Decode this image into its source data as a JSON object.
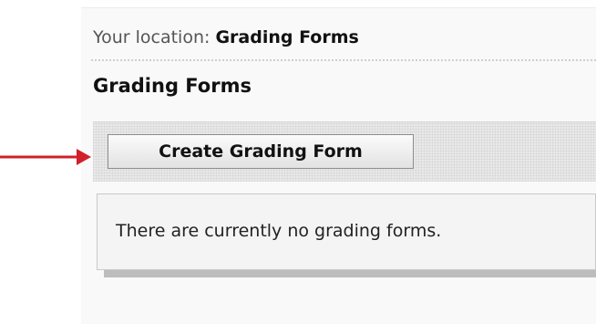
{
  "location": {
    "prefix": "Your location:",
    "current": "Grading Forms"
  },
  "page": {
    "title": "Grading Forms"
  },
  "toolbar": {
    "create_label": "Create Grading Form"
  },
  "content": {
    "empty_message": "There are currently no grading forms."
  },
  "annotation": {
    "arrow_color": "#d0202a"
  }
}
